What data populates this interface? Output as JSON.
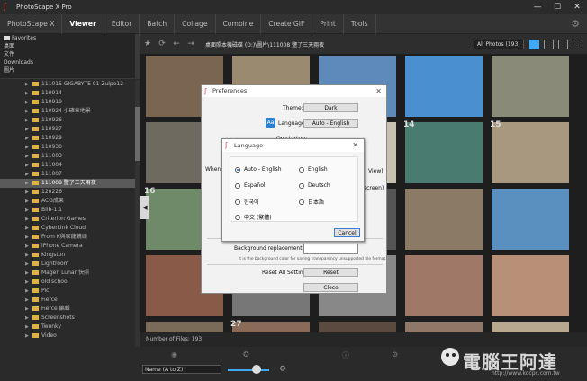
{
  "window": {
    "title": "PhotoScape X Pro",
    "minimize": "—",
    "maximize": "☐",
    "close": "✕"
  },
  "menu": {
    "tabs": [
      "PhotoScape X",
      "Viewer",
      "Editor",
      "Batch",
      "Collage",
      "Combine",
      "Create GIF",
      "Print",
      "Tools"
    ],
    "active": "Viewer"
  },
  "quick_access": [
    "Favorites",
    "桌面",
    "文件",
    "Downloads",
    "圖片"
  ],
  "tree": {
    "items": [
      "111015 GIGABYTE 01 Zulpe12",
      "110914",
      "110919",
      "110924 小確幸地景",
      "110926",
      "110927",
      "110929",
      "110930",
      "111003",
      "111004",
      "111007",
      "111008 鹽了三天兩夜",
      "120226",
      "ACG成果",
      "Blib-1.1",
      "Criterion Games",
      "CyberLink Cloud",
      "From K與家龍鏡頭",
      "iPhone Camera",
      "Kingston",
      "Lightroom",
      "Magen Lunar 快照",
      "old school",
      "Pic",
      "Fierce",
      "Fierce 編輯",
      "Screenshots",
      "Twonky",
      "Video"
    ],
    "selected": "111008 鹽了三天兩夜"
  },
  "toolbar": {
    "path": "桌面照本機磁碟 (D:)\\圖片\\111008 鹽了三天兩夜",
    "filter": "All Photos (193)"
  },
  "thumbnails": [
    {
      "num": "",
      "color": "#7a6650"
    },
    {
      "num": "",
      "color": "#9a8a70"
    },
    {
      "num": "",
      "color": "#5d8ab8"
    },
    {
      "num": "",
      "color": "#4a8fd0"
    },
    {
      "num": "",
      "color": "#8a8a78"
    },
    {
      "num": "",
      "color": "#6e6a60"
    },
    {
      "num": "",
      "color": "#b8b4a8"
    },
    {
      "num": "",
      "color": "#c8c0b0"
    },
    {
      "num": "14",
      "color": "#4a7b70"
    },
    {
      "num": "15",
      "color": "#a89880"
    },
    {
      "num": "16",
      "color": "#6f8a68"
    },
    {
      "num": "",
      "color": "#555"
    },
    {
      "num": "",
      "color": "#555"
    },
    {
      "num": "",
      "color": "#8a7a66"
    },
    {
      "num": "",
      "color": "#5a90c0"
    },
    {
      "num": "",
      "color": "#8a5a48"
    },
    {
      "num": "",
      "color": "#777"
    },
    {
      "num": "",
      "color": "#888"
    },
    {
      "num": "",
      "color": "#a07868"
    },
    {
      "num": "",
      "color": "#b89078"
    },
    {
      "num": "",
      "color": "#7a6a58"
    },
    {
      "num": "27",
      "color": "#8a6a58"
    },
    {
      "num": "",
      "color": "#5a4a40"
    },
    {
      "num": "",
      "color": "#907868"
    },
    {
      "num": "",
      "color": "#b8a890"
    }
  ],
  "status": {
    "files": "Number of Files: 193"
  },
  "bottom": {
    "sort": "Name (A to Z)"
  },
  "watermark": {
    "text": "電腦王阿達",
    "url": "http://www.kocpc.com.tw"
  },
  "preferences": {
    "title": "Preferences",
    "theme_label": "Theme:",
    "theme_value": "Dark",
    "language_label": "Language:",
    "language_value": "Auto - English",
    "on_startup_label": "On startup:",
    "when_label": "When o",
    "view_text": "View)",
    "screen_text": "screen)",
    "bg_color_label": "Background replacement color:",
    "bg_color_hint": "It is the background color for saving transparency unsupported file format.",
    "reset_label": "Reset All Settings:",
    "reset_button": "Reset",
    "close_button": "Close",
    "language_icon": "Aa"
  },
  "language_dialog": {
    "title": "Language",
    "options": [
      {
        "label": "Auto - English",
        "selected": true
      },
      {
        "label": "English",
        "selected": false
      },
      {
        "label": "Español",
        "selected": false
      },
      {
        "label": "Deutsch",
        "selected": false
      },
      {
        "label": "한국어",
        "selected": false
      },
      {
        "label": "日本語",
        "selected": false
      },
      {
        "label": "中文 (繁體)",
        "selected": false
      }
    ],
    "cancel": "Cancel"
  },
  "icons": {
    "app": "photoscape-logo-icon",
    "settings": "gear-icon",
    "star": "star-icon",
    "refresh": "refresh-icon",
    "back": "arrow-left-icon",
    "forward": "arrow-right-icon",
    "view_grid": "grid-view-icon",
    "view_list": "list-view-icon"
  },
  "colors": {
    "accent": "#3fa9f5",
    "folder": "#e0b040",
    "logo": "#e04848"
  }
}
